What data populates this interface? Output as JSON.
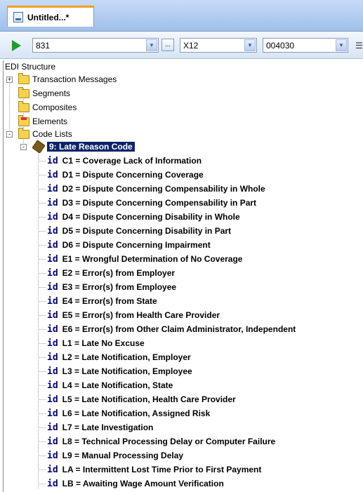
{
  "tab": {
    "title": "Untitled...*",
    "icon": "document-icon"
  },
  "toolbar": {
    "run_icon": "play-icon",
    "transaction": "831",
    "standard": "X12",
    "version": "004030",
    "ellipsis": "..."
  },
  "tree": {
    "root": "EDI Structure",
    "nodes": [
      {
        "label": "Transaction Messages",
        "expand": "+"
      },
      {
        "label": "Segments"
      },
      {
        "label": "Composites"
      },
      {
        "label": "Elements"
      },
      {
        "label": "Code Lists",
        "expand": "-"
      }
    ],
    "code_list": {
      "label": "9: Late Reason Code",
      "expand": "-"
    },
    "id_tag": "id",
    "codes": [
      "C1 = Coverage Lack of Information",
      "D1 = Dispute Concerning Coverage",
      "D2 = Dispute Concerning Compensability in Whole",
      "D3 = Dispute Concerning Compensability in Part",
      "D4 = Dispute Concerning Disability in Whole",
      "D5 = Dispute Concerning Disability in Part",
      "D6 = Dispute Concerning Impairment",
      "E1 = Wrongful Determination of No Coverage",
      "E2 = Error(s) from Employer",
      "E3 = Error(s) from Employee",
      "E4 = Error(s) from State",
      "E5 = Error(s) from Health Care Provider",
      "E6 = Error(s) from Other Claim Administrator, Independent",
      "L1 = Late No Excuse",
      "L2 = Late Notification, Employer",
      "L3 = Late Notification, Employee",
      "L4 = Late Notification, State",
      "L5 = Late Notification, Health Care Provider",
      "L6 = Late Notification, Assigned Risk",
      "L7 = Late Investigation",
      "L8 = Technical Processing Delay or Computer Failure",
      "L9 = Manual Processing Delay",
      "LA = Intermittent Lost Time Prior to First Payment",
      "LB = Awaiting Wage Amount Verification"
    ]
  }
}
